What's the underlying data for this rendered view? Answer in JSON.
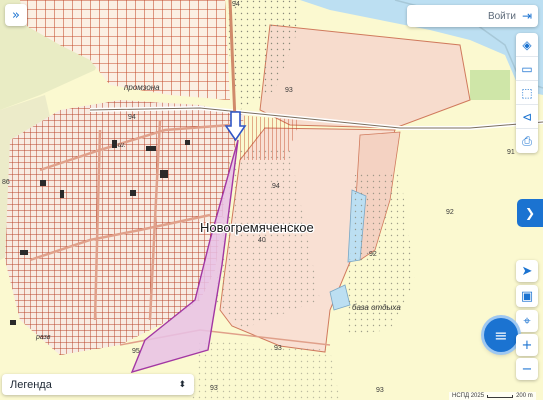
{
  "map": {
    "settlement_name": "Новогремяченское",
    "labels": {
      "promzona": "промзона",
      "base": "база отдыха",
      "school": "ш.",
      "razv": "разв"
    },
    "numbers": {
      "n94_top": "94",
      "n93_a": "93",
      "n94_mid": "94",
      "n86": "86",
      "n91": "91",
      "n92_a": "92",
      "n92_b": "92",
      "n93_b": "93",
      "n93_c": "93",
      "n95": "95",
      "n93_d": "93",
      "n94_small": "94",
      "n40": "40"
    }
  },
  "ui": {
    "login_label": "Войти",
    "legend_label": "Легенда",
    "footer_copyright": "НСПД 2025",
    "scale_label": "200 m"
  },
  "icons": {
    "expand": "»",
    "exit": "⇥",
    "layers": "◈",
    "ruler": "▭",
    "select": "⬚",
    "share": "⊲",
    "print": "⎙",
    "locate": "➤",
    "capture": "▣",
    "pin": "⌖",
    "zoom_in": "+",
    "zoom_out": "−",
    "menu": "≡",
    "side_tab": "❯"
  },
  "colors": {
    "accent": "#1b73d1",
    "parcel_line": "#c44c2c",
    "highlight_fill": "#e7c1e6",
    "highlight_stroke": "#a237a3",
    "river": "#bcdff2"
  }
}
